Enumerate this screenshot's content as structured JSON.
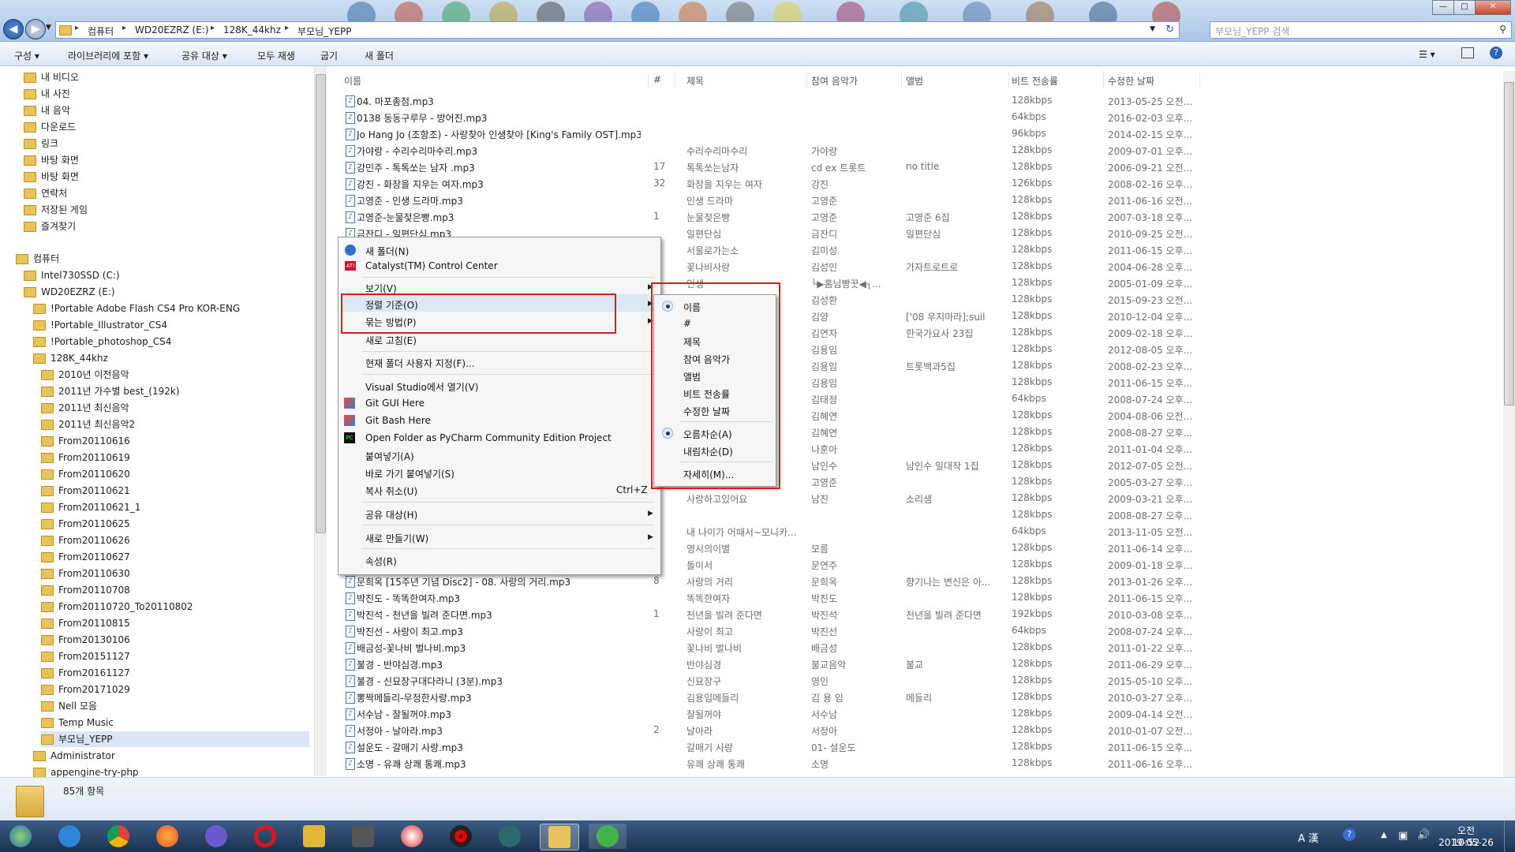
{
  "address": {
    "crumbs": [
      "컴퓨터",
      "WD20EZRZ (E:)",
      "128K_44khz",
      "부모님_YEPP"
    ],
    "search_placeholder": "부모님_YEPP 검색"
  },
  "toolbar": {
    "organize": "구성",
    "include_library": "라이브러리에 포함",
    "share_with": "공유 대상",
    "play_all": "모두 재생",
    "burn": "굽기",
    "new_folder": "새 폴더"
  },
  "nav": {
    "favorites": [
      "내 비디오",
      "내 사진",
      "내 음악",
      "다운로드",
      "링크",
      "바탕 화면",
      "바탕 화면",
      "연락처",
      "저장된 게임",
      "즐겨찾기"
    ],
    "computer": "컴퓨터",
    "drive_c": "Intel730SSD (C:)",
    "drive_e": "WD20EZRZ (E:)",
    "drive_e_items": [
      "!Portable Adobe Flash CS4 Pro KOR-ENG",
      "!Portable_Illustrator_CS4",
      "!Portable_photoshop_CS4",
      "128K_44khz"
    ],
    "subfolders": [
      "2010년 이전음악",
      "2011년 가수별 best_(192k)",
      "2011년 최신음악",
      "2011년 최신음악2",
      "From20110616",
      "From20110619",
      "From20110620",
      "From20110621",
      "From20110621_1",
      "From20110625",
      "From20110626",
      "From20110627",
      "From20110630",
      "From20110708",
      "From20110720_To20110802",
      "From20110815",
      "From20130106",
      "From20151127",
      "From20161127",
      "From20171029",
      "Nell 모음",
      "Temp Music",
      "부모님_YEPP"
    ],
    "after": [
      "Administrator",
      "appengine-try-php"
    ]
  },
  "columns": {
    "name": "이름",
    "num": "#",
    "title": "제목",
    "artist": "참여 음악가",
    "album": "앨범",
    "bitrate": "비트 전송률",
    "modified": "수정한 날짜"
  },
  "files": [
    {
      "name": "04. 마포종점.mp3",
      "num": "",
      "title": "",
      "artist": "",
      "album": "",
      "bitrate": "128kbps",
      "modified": "2013-05-25 오전..."
    },
    {
      "name": "0138 동동구루무 - 방어진.mp3",
      "num": "",
      "title": "",
      "artist": "",
      "album": "",
      "bitrate": "64kbps",
      "modified": "2016-02-03 오후..."
    },
    {
      "name": "Jo Hang Jo (조항조) - 사랑찾아 인생찾아 [King's Family OST].mp3",
      "num": "",
      "title": "",
      "artist": "",
      "album": "",
      "bitrate": "96kbps",
      "modified": "2014-02-15 오후..."
    },
    {
      "name": "가야랑 - 수리수리마수리.mp3",
      "num": "",
      "title": "수리수리마수리",
      "artist": "가야랑",
      "album": "",
      "bitrate": "128kbps",
      "modified": "2009-07-01 오후..."
    },
    {
      "name": "강민주 - 톡톡쏘는 남자 .mp3",
      "num": "17",
      "title": "톡톡쏘는남자",
      "artist": "cd ex 트롯트",
      "album": "no title",
      "bitrate": "128kbps",
      "modified": "2006-09-21 오전..."
    },
    {
      "name": "강진 - 화장을 지우는 여자.mp3",
      "num": "32",
      "title": "화장을 지우는 여자",
      "artist": "강진",
      "album": "",
      "bitrate": "126kbps",
      "modified": "2008-02-16 오후..."
    },
    {
      "name": "고영준 - 인생 드라마.mp3",
      "num": "",
      "title": "인생 드라마",
      "artist": "고영준",
      "album": "",
      "bitrate": "128kbps",
      "modified": "2011-06-16 오전..."
    },
    {
      "name": "고영준-눈물젖은빵.mp3",
      "num": "1",
      "title": "눈물젖은빵",
      "artist": "고영준",
      "album": "고영준 6집",
      "bitrate": "128kbps",
      "modified": "2007-03-18 오후..."
    },
    {
      "name": "금잔디 - 일편단심.mp3",
      "num": "",
      "title": "일편단심",
      "artist": "금잔디",
      "album": "일편단심",
      "bitrate": "128kbps",
      "modified": "2010-09-25 오전..."
    },
    {
      "name": "",
      "num": "",
      "title": "서울로가는소",
      "artist": "김미성",
      "album": "",
      "bitrate": "128kbps",
      "modified": "2011-06-15 오후..."
    },
    {
      "name": "",
      "num": "",
      "title": "꽃나비사랑",
      "artist": "김성민",
      "album": "가자트로트로",
      "bitrate": "128kbps",
      "modified": "2004-06-28 오후..."
    },
    {
      "name": "",
      "num": "",
      "title": "인생",
      "artist": "└▶홈님빵꿋◀┐...",
      "album": "",
      "bitrate": "128kbps",
      "modified": "2005-01-09 오후..."
    },
    {
      "name": "",
      "num": "",
      "title": "",
      "artist": "김성환",
      "album": "",
      "bitrate": "128kbps",
      "modified": "2015-09-23 오전..."
    },
    {
      "name": "",
      "num": "",
      "title": "",
      "artist": "김양",
      "album": "['08 우지마라];suil",
      "bitrate": "128kbps",
      "modified": "2010-12-04 오후..."
    },
    {
      "name": "",
      "num": "",
      "title": "",
      "artist": "김연자",
      "album": "한국가요사 23집",
      "bitrate": "128kbps",
      "modified": "2009-02-18 오후..."
    },
    {
      "name": "",
      "num": "",
      "title": "",
      "artist": "김용임",
      "album": "",
      "bitrate": "128kbps",
      "modified": "2012-08-05 오후..."
    },
    {
      "name": "",
      "num": "",
      "title": "",
      "artist": "김용임",
      "album": "트롯백과5집",
      "bitrate": "128kbps",
      "modified": "2008-02-23 오후..."
    },
    {
      "name": "",
      "num": "",
      "title": "",
      "artist": "김용임",
      "album": "",
      "bitrate": "128kbps",
      "modified": "2011-06-15 오후..."
    },
    {
      "name": "",
      "num": "",
      "title": "",
      "artist": "김태정",
      "album": "",
      "bitrate": "64kbps",
      "modified": "2008-07-24 오후..."
    },
    {
      "name": "",
      "num": "",
      "title": "",
      "artist": "김혜연",
      "album": "",
      "bitrate": "128kbps",
      "modified": "2004-08-06 오전..."
    },
    {
      "name": "",
      "num": "",
      "title": "",
      "artist": "김혜연",
      "album": "",
      "bitrate": "128kbps",
      "modified": "2008-08-27 오후..."
    },
    {
      "name": "",
      "num": "",
      "title": "",
      "artist": "나훈아",
      "album": "",
      "bitrate": "128kbps",
      "modified": "2011-01-04 오후..."
    },
    {
      "name": "",
      "num": "",
      "title": "",
      "artist": "남인수",
      "album": "남인수 일대작 1집",
      "bitrate": "128kbps",
      "modified": "2012-07-05 오전..."
    },
    {
      "name": "",
      "num": "",
      "title": "",
      "artist": "고영준",
      "album": "",
      "bitrate": "128kbps",
      "modified": "2005-03-27 오후..."
    },
    {
      "name": "",
      "num": "",
      "title": "사랑하고있어요",
      "artist": "남진",
      "album": "소리샘",
      "bitrate": "128kbps",
      "modified": "2009-03-21 오후..."
    },
    {
      "name": "",
      "num": "",
      "title": "",
      "artist": "",
      "album": "",
      "bitrate": "128kbps",
      "modified": "2008-08-27 오후..."
    },
    {
      "name": "",
      "num": "",
      "title": "내 나이가 어때서~모니카...",
      "artist": "",
      "album": "",
      "bitrate": "64kbps",
      "modified": "2013-11-05 오전..."
    },
    {
      "name": "",
      "num": "",
      "title": "영시의이별",
      "artist": "모름",
      "album": "",
      "bitrate": "128kbps",
      "modified": "2011-06-14 오후..."
    },
    {
      "name": "",
      "num": "",
      "title": "돌이서",
      "artist": "문연주",
      "album": "",
      "bitrate": "128kbps",
      "modified": "2009-01-18 오후..."
    },
    {
      "name": "문희옥 [15주년 기념 Disc2] - 08. 사랑의 거리.mp3",
      "num": "8",
      "title": "사랑의 거리",
      "artist": "문희옥",
      "album": "향기나는 변신은 아...",
      "bitrate": "128kbps",
      "modified": "2013-01-26 오후..."
    },
    {
      "name": "박진도 - 똑똑한여자.mp3",
      "num": "",
      "title": "똑똑한여자",
      "artist": "박진도",
      "album": "",
      "bitrate": "128kbps",
      "modified": "2011-06-15 오후..."
    },
    {
      "name": "박진석 - 천년을 빌려 준다면.mp3",
      "num": "1",
      "title": "천년을 빌려 준다면",
      "artist": "박진석",
      "album": "천년을 빌려 준다면",
      "bitrate": "192kbps",
      "modified": "2010-03-08 오후..."
    },
    {
      "name": "박진선 - 사랑이 최고.mp3",
      "num": "",
      "title": "사랑이 최고",
      "artist": "박진선",
      "album": "",
      "bitrate": "64kbps",
      "modified": "2008-07-24 오후..."
    },
    {
      "name": "배금성-꽃나비 벌나비.mp3",
      "num": "",
      "title": "꽃나비 벌나비",
      "artist": "배금성",
      "album": "",
      "bitrate": "128kbps",
      "modified": "2011-01-22 오후..."
    },
    {
      "name": "불경 - 반야심경.mp3",
      "num": "",
      "title": "반야심경",
      "artist": "불교음악",
      "album": "불교",
      "bitrate": "128kbps",
      "modified": "2011-06-29 오후..."
    },
    {
      "name": "불경 - 신묘장구대다라니 (3분).mp3",
      "num": "",
      "title": "신묘장구",
      "artist": "영인",
      "album": "",
      "bitrate": "128kbps",
      "modified": "2015-05-10 오후..."
    },
    {
      "name": "뽕짝메들리-무정한사랑.mp3",
      "num": "",
      "title": "김용임메들리",
      "artist": "김 용 임",
      "album": "메들리",
      "bitrate": "128kbps",
      "modified": "2010-03-27 오후..."
    },
    {
      "name": "서수남 - 잘될꺼야.mp3",
      "num": "",
      "title": "잘될꺼야",
      "artist": "서수남",
      "album": "",
      "bitrate": "128kbps",
      "modified": "2009-04-14 오전..."
    },
    {
      "name": "서정아 - 날아라.mp3",
      "num": "2",
      "title": "날아라",
      "artist": "서정아",
      "album": "",
      "bitrate": "128kbps",
      "modified": "2010-01-07 오전..."
    },
    {
      "name": "설운도 - 갈매기 사랑.mp3",
      "num": "",
      "title": "갈매기 사랑",
      "artist": "01- 설운도",
      "album": "",
      "bitrate": "128kbps",
      "modified": "2011-06-15 오후..."
    },
    {
      "name": "소명 - 유쾌 상쾌 통쾌.mp3",
      "num": "",
      "title": "유쾌 상쾌 통쾌",
      "artist": "소명",
      "album": "",
      "bitrate": "128kbps",
      "modified": "2011-06-16 오후..."
    }
  ],
  "context_menu": {
    "new_folder": "새 폴더(N)",
    "catalyst": "Catalyst(TM) Control Center",
    "view": "보기(V)",
    "sort_by": "정렬 기준(O)",
    "group_by": "묶는 방법(P)",
    "refresh": "새로 고침(E)",
    "customize": "현재 폴더 사용자 지정(F)...",
    "open_vs": "Visual Studio에서 열기(V)",
    "git_gui": "Git GUI Here",
    "git_bash": "Git Bash Here",
    "pycharm": "Open Folder as PyCharm Community Edition Project",
    "paste": "붙여넣기(A)",
    "paste_shortcut": "바로 가기 붙여넣기(S)",
    "undo_copy": "복사 취소(U)",
    "undo_shortcut": "Ctrl+Z",
    "share_with": "공유 대상(H)",
    "new": "새로 만들기(W)",
    "properties": "속성(R)"
  },
  "sort_submenu": {
    "name": "이름",
    "num": "#",
    "title": "제목",
    "artist": "참여 음악가",
    "album": "앨범",
    "bitrate": "비트 전송률",
    "modified": "수정한 날짜",
    "ascending": "오름차순(A)",
    "descending": "내림차순(D)",
    "more": "자세히(M)..."
  },
  "status": {
    "count": "85개 항목"
  },
  "tray": {
    "time": "오전 10:52",
    "date": "2019-05-26",
    "ime": "A 漢"
  }
}
